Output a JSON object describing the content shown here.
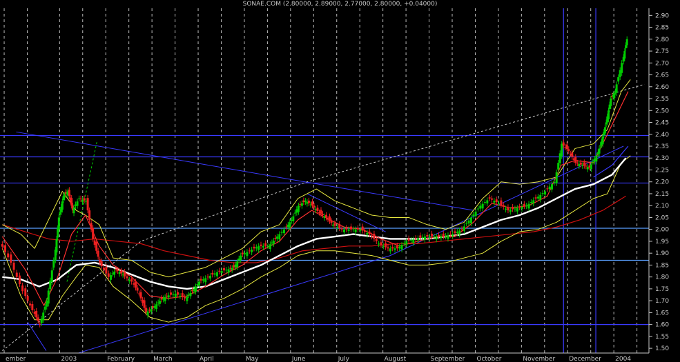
{
  "chart_data": {
    "type": "line",
    "title": "SONAE.COM (2.80000, 2.89000, 2.77000, 2.80000, +0.04000)",
    "ylim": [
      1.48,
      2.93
    ],
    "yticks": [
      "1.50",
      "1.55",
      "1.60",
      "1.65",
      "1.70",
      "1.75",
      "1.80",
      "1.85",
      "1.90",
      "1.95",
      "2.00",
      "2.05",
      "2.10",
      "2.15",
      "2.20",
      "2.25",
      "2.30",
      "2.35",
      "2.40",
      "2.45",
      "2.50",
      "2.55",
      "2.60",
      "2.65",
      "2.70",
      "2.75",
      "2.80",
      "2.85",
      "2.90"
    ],
    "x_month_labels": [
      {
        "label": "ember",
        "x": -0.9
      },
      {
        "label": "2003",
        "x": 0.3
      },
      {
        "label": "February",
        "x": 1.3
      },
      {
        "label": "March",
        "x": 2.3
      },
      {
        "label": "April",
        "x": 3.3
      },
      {
        "label": "May",
        "x": 4.3
      },
      {
        "label": "June",
        "x": 5.3
      },
      {
        "label": "July",
        "x": 6.3
      },
      {
        "label": "August",
        "x": 7.3
      },
      {
        "label": "September",
        "x": 8.3
      },
      {
        "label": "October",
        "x": 9.3
      },
      {
        "label": "November",
        "x": 10.3
      },
      {
        "label": "December",
        "x": 11.3
      },
      {
        "label": "2004",
        "x": 12.3
      }
    ],
    "xlim": [
      -1.05,
      13.0
    ],
    "horizontal_levels": [
      {
        "y": 2.395,
        "color": "#3a3aff"
      },
      {
        "y": 2.305,
        "color": "#3a3aff"
      },
      {
        "y": 2.195,
        "color": "#3a3aff"
      },
      {
        "y": 2.005,
        "color": "#5aa0ff"
      },
      {
        "y": 1.87,
        "color": "#5aa0ff"
      },
      {
        "y": 1.6,
        "color": "#3a3aff"
      }
    ],
    "vertical_levels": [
      {
        "x": 11.15,
        "color": "#3a3aff"
      },
      {
        "x": 11.85,
        "color": "#3a3aff"
      }
    ],
    "trendlines": [
      {
        "color": "#3a3aff",
        "points": [
          [
            -0.7,
            2.41
          ],
          [
            5.55,
            2.2
          ],
          [
            9.2,
            2.08
          ]
        ]
      },
      {
        "color": "#3a3aff",
        "points": [
          [
            0.65,
            1.48
          ],
          [
            7.4,
            1.89
          ],
          [
            12.45,
            2.35
          ]
        ]
      },
      {
        "color": "#3a3aff",
        "points": [
          [
            5.6,
            2.15
          ],
          [
            7.3,
            1.99
          ]
        ]
      },
      {
        "color": "#cccccc",
        "dashed": true,
        "points": [
          [
            -1.0,
            1.49
          ],
          [
            2.0,
            1.95
          ],
          [
            5.6,
            2.2
          ],
          [
            12.9,
            2.61
          ]
        ]
      },
      {
        "color": "#00d000",
        "dashed": true,
        "points": [
          [
            0.4,
            1.78
          ],
          [
            1.05,
            2.37
          ]
        ]
      },
      {
        "color": "#3a3aff",
        "points": [
          [
            -0.45,
            1.61
          ],
          [
            -0.05,
            1.49
          ]
        ]
      }
    ],
    "close": {
      "color": "#00cc00",
      "points": [
        [
          -1.0,
          1.95
        ],
        [
          -0.75,
          1.86
        ],
        [
          -0.5,
          1.74
        ],
        [
          -0.3,
          1.66
        ],
        [
          -0.15,
          1.6
        ],
        [
          0.0,
          1.7
        ],
        [
          0.15,
          1.87
        ],
        [
          0.25,
          2.05
        ],
        [
          0.35,
          2.14
        ],
        [
          0.45,
          2.16
        ],
        [
          0.55,
          2.08
        ],
        [
          0.7,
          2.13
        ],
        [
          0.85,
          2.12
        ],
        [
          1.0,
          1.96
        ],
        [
          1.15,
          1.86
        ],
        [
          1.35,
          1.8
        ],
        [
          1.5,
          1.83
        ],
        [
          1.65,
          1.81
        ],
        [
          1.85,
          1.78
        ],
        [
          2.0,
          1.73
        ],
        [
          2.15,
          1.65
        ],
        [
          2.3,
          1.67
        ],
        [
          2.45,
          1.7
        ],
        [
          2.6,
          1.72
        ],
        [
          2.8,
          1.73
        ],
        [
          3.0,
          1.71
        ],
        [
          3.15,
          1.74
        ],
        [
          3.3,
          1.78
        ],
        [
          3.5,
          1.8
        ],
        [
          3.7,
          1.82
        ],
        [
          3.9,
          1.83
        ],
        [
          4.05,
          1.84
        ],
        [
          4.2,
          1.89
        ],
        [
          4.4,
          1.91
        ],
        [
          4.6,
          1.93
        ],
        [
          4.8,
          1.93
        ],
        [
          4.95,
          1.96
        ],
        [
          5.15,
          2.0
        ],
        [
          5.3,
          2.04
        ],
        [
          5.45,
          2.1
        ],
        [
          5.6,
          2.12
        ],
        [
          5.75,
          2.1
        ],
        [
          5.9,
          2.07
        ],
        [
          6.05,
          2.05
        ],
        [
          6.2,
          2.02
        ],
        [
          6.4,
          2.0
        ],
        [
          6.6,
          2.0
        ],
        [
          6.8,
          2.0
        ],
        [
          7.0,
          1.98
        ],
        [
          7.2,
          1.94
        ],
        [
          7.4,
          1.92
        ],
        [
          7.6,
          1.92
        ],
        [
          7.8,
          1.95
        ],
        [
          8.0,
          1.96
        ],
        [
          8.2,
          1.97
        ],
        [
          8.4,
          1.97
        ],
        [
          8.6,
          1.97
        ],
        [
          8.8,
          1.98
        ],
        [
          9.0,
          2.0
        ],
        [
          9.2,
          2.05
        ],
        [
          9.4,
          2.1
        ],
        [
          9.6,
          2.13
        ],
        [
          9.8,
          2.11
        ],
        [
          10.0,
          2.08
        ],
        [
          10.2,
          2.09
        ],
        [
          10.4,
          2.1
        ],
        [
          10.6,
          2.13
        ],
        [
          10.8,
          2.16
        ],
        [
          11.0,
          2.2
        ],
        [
          11.15,
          2.36
        ],
        [
          11.3,
          2.33
        ],
        [
          11.45,
          2.28
        ],
        [
          11.6,
          2.27
        ],
        [
          11.75,
          2.26
        ],
        [
          11.9,
          2.31
        ],
        [
          12.0,
          2.37
        ],
        [
          12.1,
          2.45
        ],
        [
          12.2,
          2.55
        ],
        [
          12.3,
          2.58
        ],
        [
          12.45,
          2.7
        ],
        [
          12.55,
          2.8
        ]
      ]
    },
    "ma_short": {
      "color": "#ff3030",
      "points": [
        [
          -1.0,
          1.97
        ],
        [
          -0.5,
          1.83
        ],
        [
          -0.1,
          1.68
        ],
        [
          0.2,
          1.8
        ],
        [
          0.5,
          1.98
        ],
        [
          0.8,
          2.06
        ],
        [
          1.1,
          1.93
        ],
        [
          1.4,
          1.85
        ],
        [
          1.8,
          1.8
        ],
        [
          2.2,
          1.72
        ],
        [
          2.6,
          1.71
        ],
        [
          3.0,
          1.72
        ],
        [
          3.4,
          1.76
        ],
        [
          3.8,
          1.81
        ],
        [
          4.2,
          1.85
        ],
        [
          4.6,
          1.91
        ],
        [
          5.0,
          1.95
        ],
        [
          5.4,
          2.04
        ],
        [
          5.7,
          2.08
        ],
        [
          6.0,
          2.05
        ],
        [
          6.4,
          2.01
        ],
        [
          6.8,
          2.0
        ],
        [
          7.2,
          1.96
        ],
        [
          7.6,
          1.93
        ],
        [
          8.0,
          1.95
        ],
        [
          8.4,
          1.97
        ],
        [
          8.8,
          1.97
        ],
        [
          9.2,
          2.03
        ],
        [
          9.6,
          2.11
        ],
        [
          10.0,
          2.09
        ],
        [
          10.4,
          2.1
        ],
        [
          10.8,
          2.14
        ],
        [
          11.1,
          2.27
        ],
        [
          11.4,
          2.29
        ],
        [
          11.8,
          2.28
        ],
        [
          12.1,
          2.4
        ],
        [
          12.4,
          2.52
        ],
        [
          12.55,
          2.58
        ]
      ]
    },
    "ma_mid": {
      "color": "#ffffff",
      "points": [
        [
          -1.0,
          1.8
        ],
        [
          -0.6,
          1.79
        ],
        [
          -0.2,
          1.76
        ],
        [
          0.2,
          1.79
        ],
        [
          0.6,
          1.85
        ],
        [
          1.0,
          1.86
        ],
        [
          1.4,
          1.84
        ],
        [
          1.8,
          1.81
        ],
        [
          2.2,
          1.78
        ],
        [
          2.6,
          1.76
        ],
        [
          3.0,
          1.75
        ],
        [
          3.4,
          1.76
        ],
        [
          3.8,
          1.79
        ],
        [
          4.2,
          1.82
        ],
        [
          4.6,
          1.85
        ],
        [
          5.0,
          1.89
        ],
        [
          5.4,
          1.93
        ],
        [
          5.8,
          1.96
        ],
        [
          6.2,
          1.97
        ],
        [
          6.6,
          1.98
        ],
        [
          7.0,
          1.97
        ],
        [
          7.4,
          1.96
        ],
        [
          7.8,
          1.96
        ],
        [
          8.2,
          1.96
        ],
        [
          8.6,
          1.97
        ],
        [
          9.0,
          1.98
        ],
        [
          9.4,
          2.01
        ],
        [
          9.8,
          2.04
        ],
        [
          10.2,
          2.06
        ],
        [
          10.6,
          2.09
        ],
        [
          11.0,
          2.13
        ],
        [
          11.4,
          2.17
        ],
        [
          11.8,
          2.19
        ],
        [
          12.2,
          2.23
        ],
        [
          12.5,
          2.3
        ]
      ]
    },
    "ma_long": {
      "color": "#cc1010",
      "points": [
        [
          -1.0,
          2.02
        ],
        [
          -0.5,
          1.99
        ],
        [
          0.0,
          1.96
        ],
        [
          0.5,
          1.95
        ],
        [
          1.0,
          1.96
        ],
        [
          1.5,
          1.95
        ],
        [
          2.0,
          1.94
        ],
        [
          2.5,
          1.91
        ],
        [
          3.0,
          1.89
        ],
        [
          3.5,
          1.87
        ],
        [
          4.0,
          1.86
        ],
        [
          4.5,
          1.86
        ],
        [
          5.0,
          1.88
        ],
        [
          5.5,
          1.91
        ],
        [
          6.0,
          1.92
        ],
        [
          6.5,
          1.93
        ],
        [
          7.0,
          1.93
        ],
        [
          7.5,
          1.94
        ],
        [
          8.0,
          1.94
        ],
        [
          8.5,
          1.95
        ],
        [
          9.0,
          1.96
        ],
        [
          9.5,
          1.97
        ],
        [
          10.0,
          1.98
        ],
        [
          10.5,
          1.99
        ],
        [
          11.0,
          2.01
        ],
        [
          11.5,
          2.04
        ],
        [
          12.0,
          2.08
        ],
        [
          12.5,
          2.14
        ]
      ]
    },
    "band_upper": {
      "color": "#e8e840",
      "points": [
        [
          -1.0,
          2.02
        ],
        [
          -0.6,
          1.98
        ],
        [
          -0.3,
          1.92
        ],
        [
          0.0,
          2.04
        ],
        [
          0.3,
          2.16
        ],
        [
          0.6,
          2.08
        ],
        [
          0.8,
          2.06
        ],
        [
          1.1,
          2.02
        ],
        [
          1.4,
          1.88
        ],
        [
          1.8,
          1.87
        ],
        [
          2.2,
          1.82
        ],
        [
          2.6,
          1.8
        ],
        [
          3.0,
          1.82
        ],
        [
          3.4,
          1.84
        ],
        [
          3.8,
          1.88
        ],
        [
          4.2,
          1.92
        ],
        [
          4.6,
          1.99
        ],
        [
          5.0,
          2.02
        ],
        [
          5.4,
          2.13
        ],
        [
          5.8,
          2.17
        ],
        [
          6.2,
          2.12
        ],
        [
          6.6,
          2.09
        ],
        [
          7.0,
          2.06
        ],
        [
          7.4,
          2.05
        ],
        [
          7.8,
          2.05
        ],
        [
          8.2,
          2.02
        ],
        [
          8.6,
          2.0
        ],
        [
          9.0,
          2.03
        ],
        [
          9.4,
          2.13
        ],
        [
          9.8,
          2.2
        ],
        [
          10.2,
          2.19
        ],
        [
          10.6,
          2.2
        ],
        [
          11.0,
          2.22
        ],
        [
          11.4,
          2.34
        ],
        [
          11.8,
          2.36
        ],
        [
          12.1,
          2.42
        ],
        [
          12.4,
          2.58
        ],
        [
          12.6,
          2.63
        ]
      ]
    },
    "band_lower": {
      "color": "#e8e840",
      "points": [
        [
          -1.0,
          1.92
        ],
        [
          -0.6,
          1.72
        ],
        [
          -0.3,
          1.62
        ],
        [
          0.0,
          1.62
        ],
        [
          0.3,
          1.72
        ],
        [
          0.6,
          1.8
        ],
        [
          0.8,
          1.85
        ],
        [
          1.1,
          1.84
        ],
        [
          1.4,
          1.76
        ],
        [
          1.8,
          1.7
        ],
        [
          2.2,
          1.63
        ],
        [
          2.6,
          1.61
        ],
        [
          3.0,
          1.63
        ],
        [
          3.4,
          1.68
        ],
        [
          3.8,
          1.71
        ],
        [
          4.2,
          1.75
        ],
        [
          4.6,
          1.8
        ],
        [
          5.0,
          1.84
        ],
        [
          5.4,
          1.89
        ],
        [
          5.8,
          1.91
        ],
        [
          6.2,
          1.91
        ],
        [
          6.6,
          1.9
        ],
        [
          7.0,
          1.89
        ],
        [
          7.4,
          1.87
        ],
        [
          7.8,
          1.85
        ],
        [
          8.2,
          1.85
        ],
        [
          8.6,
          1.86
        ],
        [
          9.0,
          1.88
        ],
        [
          9.4,
          1.9
        ],
        [
          9.8,
          1.95
        ],
        [
          10.2,
          1.99
        ],
        [
          10.6,
          2.0
        ],
        [
          11.0,
          2.03
        ],
        [
          11.4,
          2.08
        ],
        [
          11.8,
          2.13
        ],
        [
          12.1,
          2.15
        ],
        [
          12.4,
          2.28
        ],
        [
          12.6,
          2.31
        ]
      ]
    },
    "bbands_center": {
      "color": "#3a3aff",
      "points": [
        [
          11.8,
          2.22
        ],
        [
          12.2,
          2.27
        ],
        [
          12.55,
          2.35
        ]
      ]
    }
  }
}
